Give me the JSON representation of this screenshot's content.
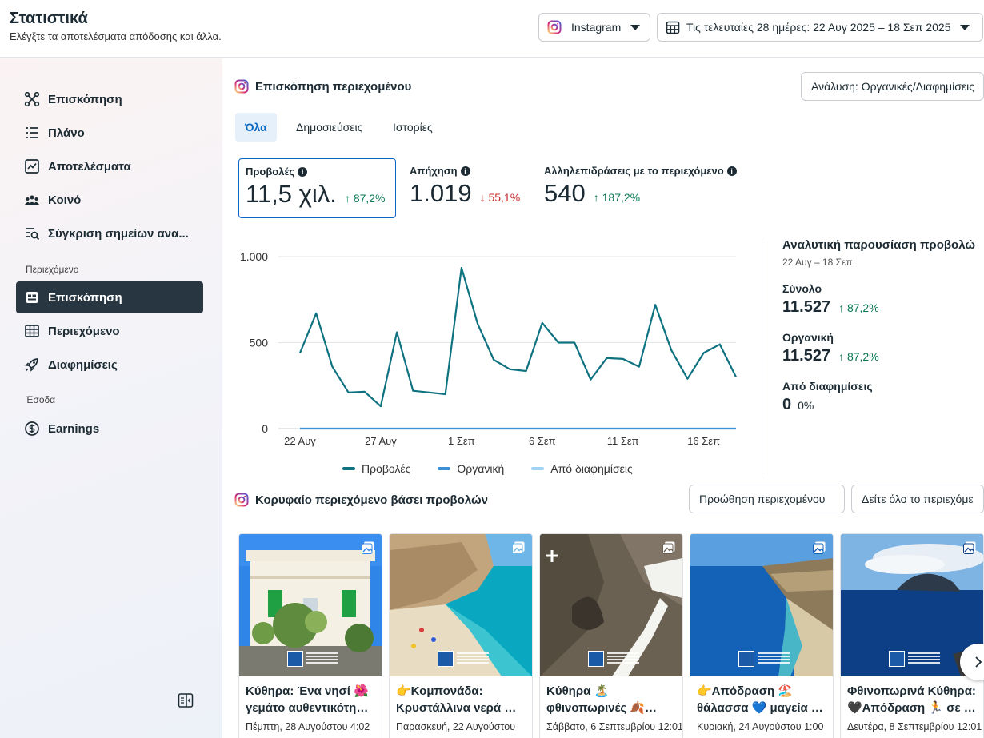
{
  "header": {
    "title": "Στατιστικά",
    "subtitle": "Ελέγξτε τα αποτελέσματα απόδοσης και άλλα.",
    "platform": "Instagram",
    "date_range": "Τις τελευταίες 28 ημέρες: 22 Αυγ 2025 – 18 Σεπ 2025"
  },
  "sidebar": {
    "items": [
      {
        "label": "Επισκόπηση",
        "icon": "hub-icon"
      },
      {
        "label": "Πλάνο",
        "icon": "list-icon"
      },
      {
        "label": "Αποτελέσματα",
        "icon": "trend-chart-icon"
      },
      {
        "label": "Κοινό",
        "icon": "people-icon"
      },
      {
        "label": "Σύγκριση σημείων ανα...",
        "icon": "compare-search-icon"
      }
    ],
    "section_content": "Περιεχόμενο",
    "content_items": [
      {
        "label": "Επισκόπηση",
        "icon": "content-overview-icon",
        "active": true
      },
      {
        "label": "Περιεχόμενο",
        "icon": "table-icon"
      },
      {
        "label": "Διαφημίσεις",
        "icon": "rocket-icon"
      }
    ],
    "section_income": "Έσοδα",
    "income_items": [
      {
        "label": "Earnings",
        "icon": "dollar-circle-icon"
      }
    ]
  },
  "overview": {
    "title": "Επισκόπηση περιεχομένου",
    "analysis_dropdown": "Ανάλυση: Οργανικές/Διαφημίσεις",
    "tabs": [
      "Όλα",
      "Δημοσιεύσεις",
      "Ιστορίες"
    ],
    "metrics": [
      {
        "label": "Προβολές",
        "value": "11,5 χιλ.",
        "change": "87,2%",
        "direction": "up"
      },
      {
        "label": "Απήχηση",
        "value": "1.019",
        "change": "55,1%",
        "direction": "down"
      },
      {
        "label": "Αλληλεπιδράσεις με το περιεχόμενο",
        "value": "540",
        "change": "187,2%",
        "direction": "up"
      }
    ]
  },
  "chart_data": {
    "type": "line",
    "x": [
      "22 Αυγ",
      "23 Αυγ",
      "24 Αυγ",
      "25 Αυγ",
      "26 Αυγ",
      "27 Αυγ",
      "28 Αυγ",
      "29 Αυγ",
      "30 Αυγ",
      "31 Αυγ",
      "1 Σεπ",
      "2 Σεπ",
      "3 Σεπ",
      "4 Σεπ",
      "5 Σεπ",
      "6 Σεπ",
      "7 Σεπ",
      "8 Σεπ",
      "9 Σεπ",
      "10 Σεπ",
      "11 Σεπ",
      "12 Σεπ",
      "13 Σεπ",
      "14 Σεπ",
      "15 Σεπ",
      "16 Σεπ",
      "17 Σεπ",
      "18 Σεπ"
    ],
    "xticks": [
      "22 Αυγ",
      "27 Αυγ",
      "1 Σεπ",
      "6 Σεπ",
      "11 Σεπ",
      "16 Σεπ"
    ],
    "yticks": [
      "1.000",
      "500",
      "0"
    ],
    "ylim": [
      0,
      1000
    ],
    "series": [
      {
        "name": "Προβολές",
        "color": "#0f7280",
        "values": [
          440,
          670,
          360,
          210,
          215,
          130,
          560,
          220,
          210,
          200,
          935,
          610,
          400,
          345,
          335,
          615,
          500,
          500,
          285,
          410,
          405,
          360,
          720,
          455,
          290,
          440,
          490,
          300
        ]
      },
      {
        "name": "Οργανική",
        "color": "#3d8fd6",
        "values": [
          0,
          0,
          0,
          0,
          0,
          0,
          0,
          0,
          0,
          0,
          0,
          0,
          0,
          0,
          0,
          0,
          0,
          0,
          0,
          0,
          0,
          0,
          0,
          0,
          0,
          0,
          0,
          0
        ]
      },
      {
        "name": "Από διαφημίσεις",
        "color": "#9fd3f5",
        "values": [
          0,
          0,
          0,
          0,
          0,
          0,
          0,
          0,
          0,
          0,
          0,
          0,
          0,
          0,
          0,
          0,
          0,
          0,
          0,
          0,
          0,
          0,
          0,
          0,
          0,
          0,
          0,
          0
        ]
      }
    ],
    "grid": true,
    "legend": "bottom"
  },
  "breakdown": {
    "title": "Αναλυτική παρουσίαση προβολώ",
    "dates": "22 Αυγ – 18 Σεπ",
    "total_label": "Σύνολο",
    "total_value": "11.527",
    "total_change": "87,2%",
    "organic_label": "Οργανική",
    "organic_value": "11.527",
    "organic_change": "87,2%",
    "ads_label": "Από διαφημίσεις",
    "ads_value": "0",
    "ads_pct": "0%"
  },
  "top_content": {
    "title": "Κορυφαίο περιεχόμενο βάσει προβολών",
    "promote_button": "Προώθηση περιεχομένου",
    "see_all_button": "Δείτε όλο το περιεχόμε",
    "cards": [
      {
        "title": "Κύθηρα: Ένα νησί 🌺 γεμάτο αυθεντικότη…",
        "date": "Πέμπτη, 28 Αυγούστου 4:02"
      },
      {
        "title": "👉Κομπονάδα: Κρυστάλλινα νερά …",
        "date": "Παρασκευή, 22 Αυγούστου"
      },
      {
        "title": "Κύθηρα 🏝️ φθινοπωρινές 🍂…",
        "date": "Σάββατο, 6 Σεπτεμβρίου 12:01"
      },
      {
        "title": "👉Απόδραση 🏖️ θάλασσα 💙 μαγεία …",
        "date": "Κυριακή, 24 Αυγούστου 1:00"
      },
      {
        "title": "Φθινοπωρινά Κύθηρα: 🖤Απόδραση 🏃 σε …",
        "date": "Δευτέρα, 8 Σεπτεμβρίου 12:01"
      }
    ]
  }
}
